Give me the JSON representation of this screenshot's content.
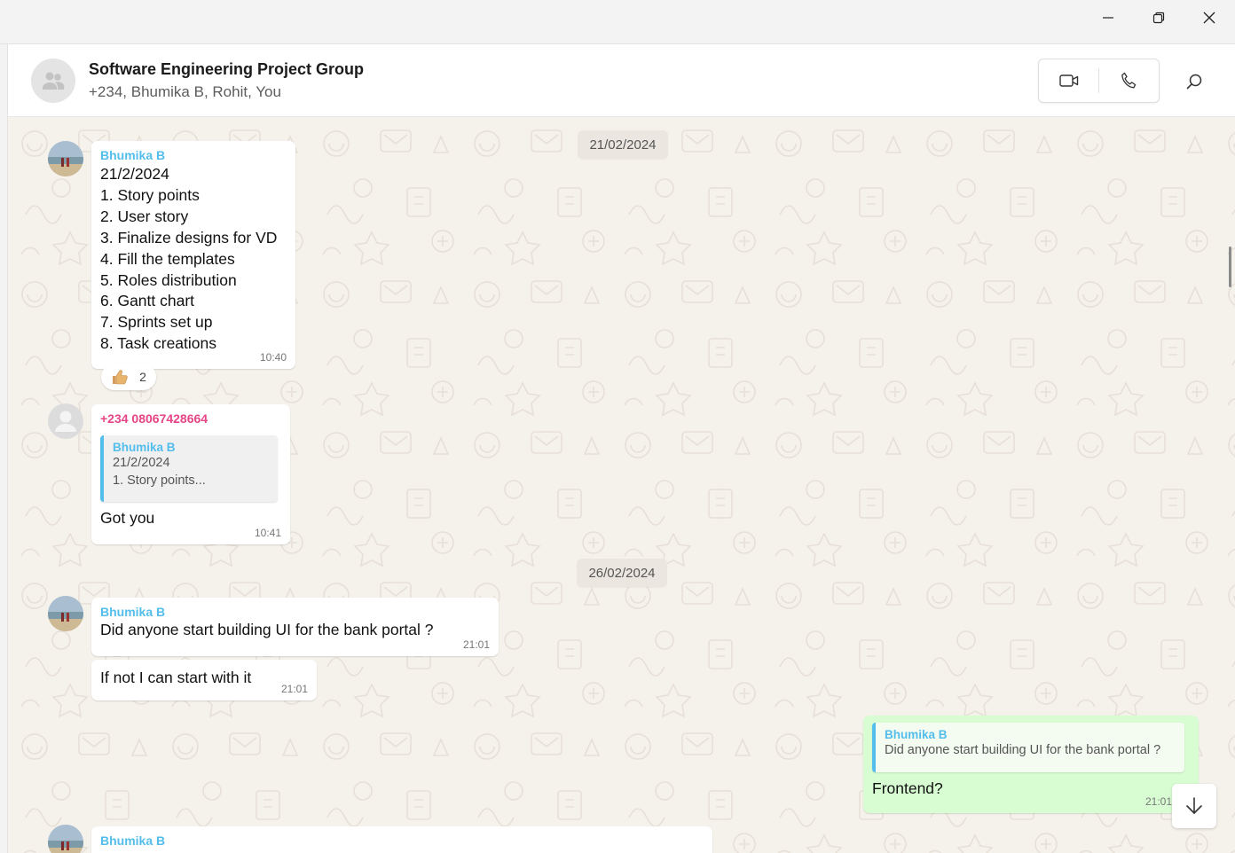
{
  "window": {
    "controls": [
      "minimize-icon",
      "restore-icon",
      "close-icon"
    ]
  },
  "header": {
    "title": "Software Engineering Project Group",
    "subtitle": "+234, Bhumika B, Rohit, You",
    "icons": [
      "group-icon",
      "video-call-icon",
      "voice-call-icon",
      "search-icon"
    ]
  },
  "chat": {
    "date_chips": [
      "21/02/2024",
      "26/02/2024"
    ],
    "messages": [
      {
        "sender": "Bhumika B",
        "lines": [
          "21/2/2024",
          "1. Story points",
          "2. User story",
          "3. Finalize designs for VD",
          "4. Fill the templates",
          "5. Roles distribution",
          "6. Gantt chart",
          "7. Sprints set up",
          "8. Task creations"
        ],
        "time": "10:40",
        "reaction": {
          "icon": "thumbs-up-icon",
          "count": "2"
        }
      },
      {
        "sender": "+234 08067428664",
        "quote": {
          "sender": "Bhumika B",
          "lines": [
            "21/2/2024",
            "1. Story points..."
          ]
        },
        "text": "Got you",
        "time": "10:41"
      },
      {
        "sender": "Bhumika B",
        "text": "Did anyone start building UI for the bank portal ?",
        "time": "21:01"
      },
      {
        "text": "If not I can start with it",
        "time": "21:01"
      },
      {
        "outgoing": true,
        "quote": {
          "sender": "Bhumika B",
          "text": "Did anyone start building UI for the bank portal ?"
        },
        "text": "Frontend?",
        "time": "21:01"
      },
      {
        "sender": "Bhumika B"
      }
    ],
    "scroll_down_icon": "arrow-down-icon"
  },
  "colors": {
    "chat_background": "#f5f1eb",
    "outgoing_bubble": "#d9fdd3",
    "sender_blue": "#53bdeb",
    "sender_pink": "#e54587"
  }
}
